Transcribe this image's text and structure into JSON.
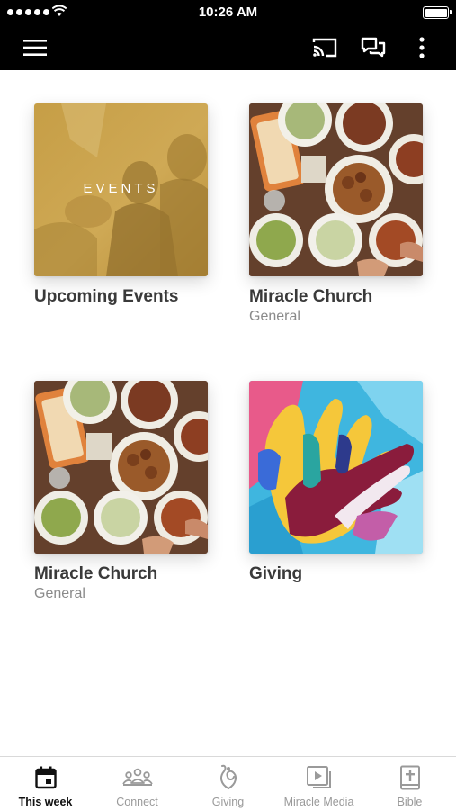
{
  "status_bar": {
    "time": "10:26 AM"
  },
  "app_bar": {
    "icons": [
      "menu-icon",
      "cast-icon",
      "chat-icon",
      "more-vertical-icon"
    ]
  },
  "cards": [
    {
      "title": "Upcoming Events",
      "subtitle": "",
      "image_label": "EVENTS",
      "image": "events-photo"
    },
    {
      "title": "Miracle Church",
      "subtitle": "General",
      "image": "food-table-photo"
    },
    {
      "title": "Miracle Church",
      "subtitle": "General",
      "image": "food-table-photo"
    },
    {
      "title": "Giving",
      "subtitle": "",
      "image": "hands-artwork"
    }
  ],
  "tabs": [
    {
      "label": "This week",
      "icon": "calendar-icon",
      "active": true
    },
    {
      "label": "Connect",
      "icon": "people-icon",
      "active": false
    },
    {
      "label": "Giving",
      "icon": "giving-icon",
      "active": false
    },
    {
      "label": "Miracle Media",
      "icon": "media-play-icon",
      "active": false
    },
    {
      "label": "Bible",
      "icon": "bible-icon",
      "active": false
    }
  ],
  "colors": {
    "header_bg": "#000000",
    "active_tab": "#111111",
    "inactive_tab": "#9a9a9a",
    "events_tint": "#c9a24a"
  }
}
